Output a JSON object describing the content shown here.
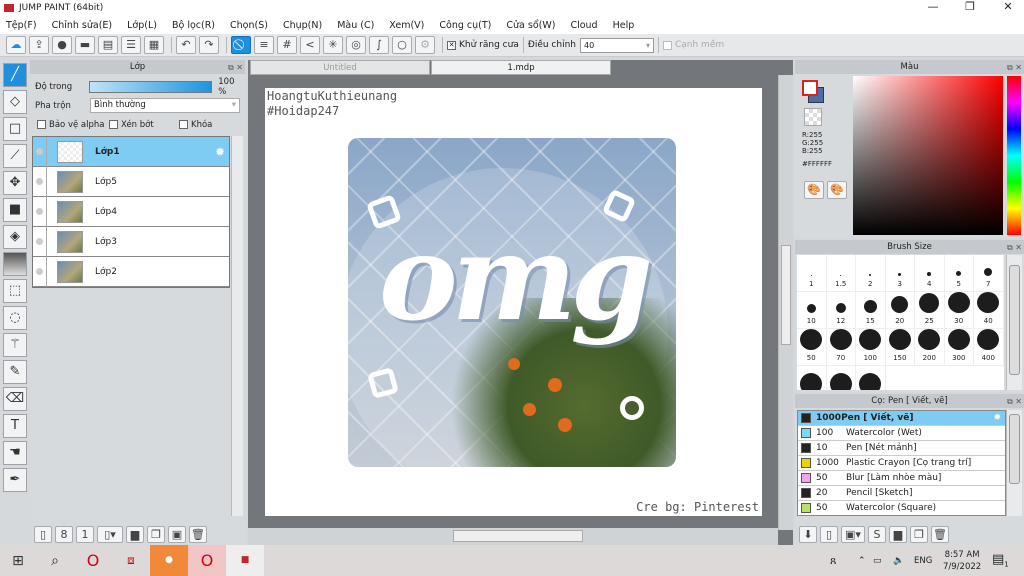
{
  "app": {
    "title": "JUMP PAINT (64bit)"
  },
  "menu": [
    "Tệp(F)",
    "Chỉnh sửa(E)",
    "Lớp(L)",
    "Bộ lọc(R)",
    "Chọn(S)",
    "Chụp(N)",
    "Màu (C)",
    "Xem(V)",
    "Công cụ(T)",
    "Cửa sổ(W)",
    "Cloud",
    "Help"
  ],
  "toolbar": {
    "antialias_label": "Khử răng cưa",
    "adjust_label": "Điều chỉnh",
    "adjust_value": "40",
    "soft_edge_label": "Cạnh mềm"
  },
  "layers": {
    "title": "Lớp",
    "opacity_label": "Độ trong",
    "opacity_value": "100 %",
    "opacity_percent": 100,
    "blend_label": "Pha trộn",
    "blend_value": "Bình thường",
    "protect_alpha": "Bảo vệ alpha",
    "clip": "Xén bớt",
    "lock": "Khóa",
    "items": [
      {
        "name": "Lớp1",
        "selected": true
      },
      {
        "name": "Lớp5"
      },
      {
        "name": "Lớp4"
      },
      {
        "name": "Lớp3"
      },
      {
        "name": "Lớp2"
      }
    ]
  },
  "documents": {
    "tabs": [
      "Untitled",
      "1.mdp"
    ],
    "active": "1.mdp"
  },
  "canvas": {
    "top_text_1": "HoangtuKuthieunang",
    "top_text_2": "#Hoidap247",
    "artwork_text": "omg",
    "bottom_text": "Cre bg: Pinterest"
  },
  "color": {
    "title": "Màu",
    "r": "R:255",
    "g": "G:255",
    "b": "B:255",
    "hex": "#FFFFFF",
    "foreground": "#FFFFFF",
    "background": "#4A6FA5"
  },
  "brush_size": {
    "title": "Brush Size",
    "sizes": [
      "1",
      "1.5",
      "2",
      "3",
      "4",
      "5",
      "7",
      "10",
      "12",
      "15",
      "20",
      "25",
      "30",
      "40",
      "50",
      "70",
      "100",
      "150",
      "200",
      "300",
      "400",
      "",
      "",
      ""
    ]
  },
  "brushes": {
    "title": "Cọ: Pen [ Viết, vẽ]",
    "items": [
      {
        "size": "1000",
        "name": "Pen [ Viết, vẽ]",
        "color": "#222222",
        "selected": true
      },
      {
        "size": "100",
        "name": "Watercolor (Wet)",
        "color": "#7fd7f7"
      },
      {
        "size": "10",
        "name": "Pen [Nét mảnh]",
        "color": "#222222"
      },
      {
        "size": "1000",
        "name": "Plastic Crayon [Cọ trang trí]",
        "color": "#e8d400"
      },
      {
        "size": "50",
        "name": "Blur [Làm nhòe màu]",
        "color": "#f5a3f0"
      },
      {
        "size": "20",
        "name": "Pencil [Sketch]",
        "color": "#222222"
      },
      {
        "size": "50",
        "name": "Watercolor (Square)",
        "color": "#b5e26a"
      }
    ]
  },
  "taskbar": {
    "lang": "ENG",
    "time": "8:57 AM",
    "date": "7/9/2022",
    "notifications": "1"
  }
}
